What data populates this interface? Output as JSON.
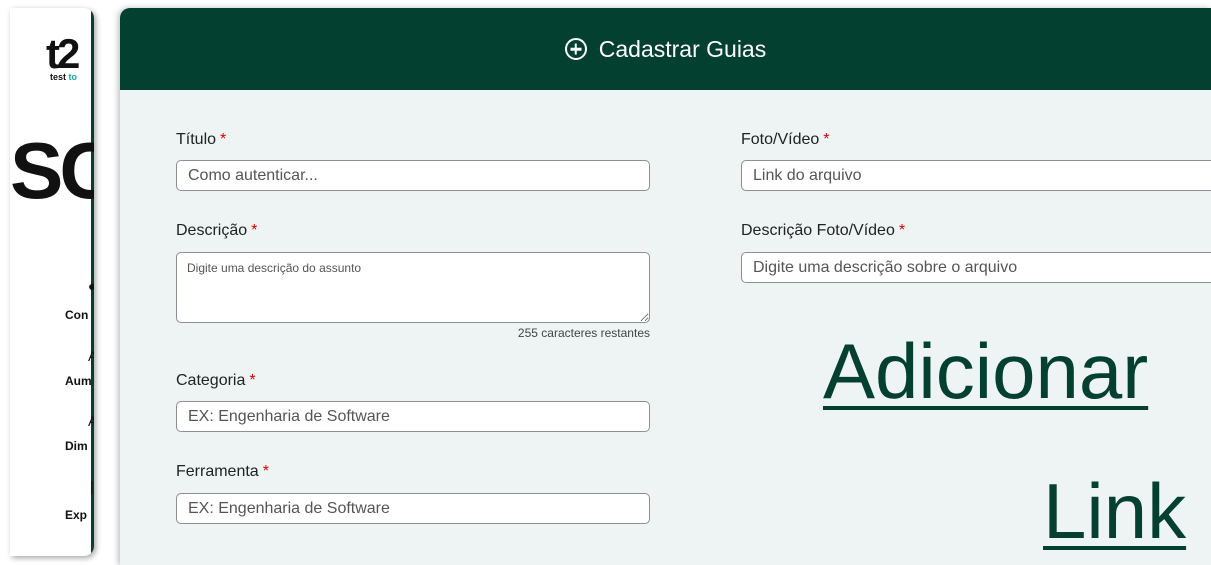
{
  "sidebar": {
    "logo_mark": "t2",
    "logo_sub_1": "test",
    "logo_sub_2": "to",
    "big_text": "SC",
    "items": [
      {
        "mark": "●",
        "label": "Con"
      },
      {
        "mark": "A",
        "label": "Aum"
      },
      {
        "mark": "A",
        "label": "Dim"
      },
      {
        "mark": "|",
        "label": "Exp"
      }
    ]
  },
  "modal": {
    "title": "Cadastrar Guias",
    "required_mark": "*",
    "fields": {
      "titulo": {
        "label": "Título",
        "placeholder": "Como autenticar..."
      },
      "descricao": {
        "label": "Descrição",
        "placeholder": "Digite uma descrição do assunto",
        "counter": "255 caracteres restantes"
      },
      "categoria": {
        "label": "Categoria",
        "placeholder": "EX: Engenharia de Software"
      },
      "ferramenta": {
        "label": "Ferramenta",
        "placeholder": "EX: Engenharia de Software"
      },
      "foto_video": {
        "label": "Foto/Vídeo",
        "placeholder": "Link do arquivo"
      },
      "descricao_foto": {
        "label": "Descrição Foto/Vídeo",
        "placeholder": "Digite uma descrição sobre o arquivo"
      }
    },
    "add_link_line1": "Adicionar",
    "add_link_line2": "Link"
  },
  "colors": {
    "header_bg": "#04402f",
    "modal_bg": "#eef3f3",
    "required": "#dd0000",
    "link": "#04402f"
  }
}
